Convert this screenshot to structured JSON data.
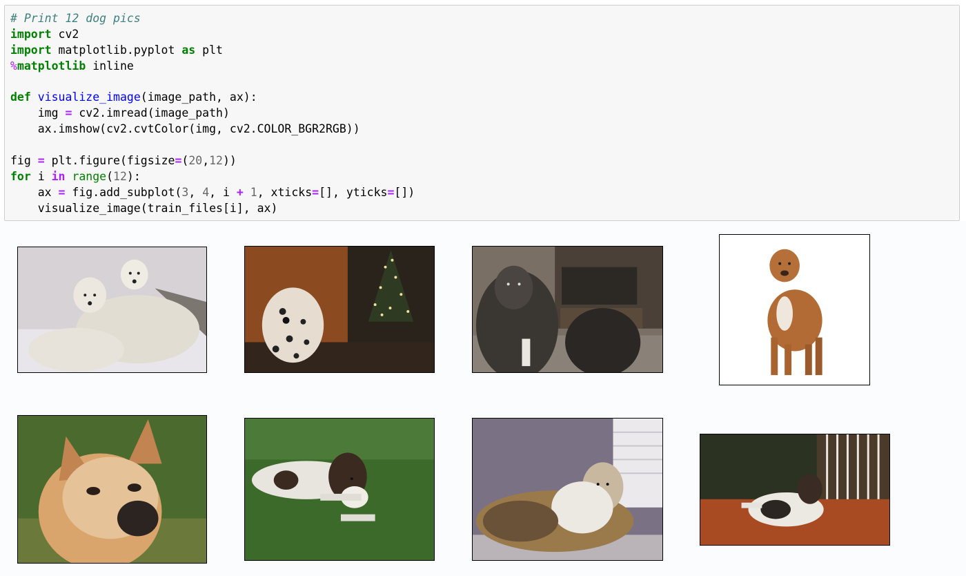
{
  "notebook": {
    "code_cell": {
      "lines": [
        [
          {
            "t": "cm",
            "v": "# Print 12 dog pics"
          }
        ],
        [
          {
            "t": "kw",
            "v": "import"
          },
          {
            "t": "",
            "v": " cv2"
          }
        ],
        [
          {
            "t": "kw",
            "v": "import"
          },
          {
            "t": "",
            "v": " matplotlib.pyplot "
          },
          {
            "t": "kw",
            "v": "as"
          },
          {
            "t": "",
            "v": " plt"
          }
        ],
        [
          {
            "t": "mg",
            "v": "%"
          },
          {
            "t": "kw",
            "v": "matplotlib"
          },
          {
            "t": "",
            "v": " inline"
          }
        ],
        [
          {
            "t": "",
            "v": " "
          }
        ],
        [
          {
            "t": "kw",
            "v": "def"
          },
          {
            "t": "",
            "v": " "
          },
          {
            "t": "fn",
            "v": "visualize_image"
          },
          {
            "t": "",
            "v": "(image_path, ax):"
          }
        ],
        [
          {
            "t": "",
            "v": "    img "
          },
          {
            "t": "op",
            "v": "="
          },
          {
            "t": "",
            "v": " cv2.imread(image_path)"
          }
        ],
        [
          {
            "t": "",
            "v": "    ax.imshow(cv2.cvtColor(img, cv2.COLOR_BGR2RGB))"
          }
        ],
        [
          {
            "t": "",
            "v": " "
          }
        ],
        [
          {
            "t": "",
            "v": "fig "
          },
          {
            "t": "op",
            "v": "="
          },
          {
            "t": "",
            "v": " plt.figure(figsize"
          },
          {
            "t": "op",
            "v": "="
          },
          {
            "t": "",
            "v": "("
          },
          {
            "t": "num",
            "v": "20"
          },
          {
            "t": "",
            "v": ","
          },
          {
            "t": "num",
            "v": "12"
          },
          {
            "t": "",
            "v": "))"
          }
        ],
        [
          {
            "t": "kw",
            "v": "for"
          },
          {
            "t": "",
            "v": " i "
          },
          {
            "t": "op",
            "v": "in"
          },
          {
            "t": "",
            "v": " "
          },
          {
            "t": "bi",
            "v": "range"
          },
          {
            "t": "",
            "v": "("
          },
          {
            "t": "num",
            "v": "12"
          },
          {
            "t": "",
            "v": "):"
          }
        ],
        [
          {
            "t": "",
            "v": "    ax "
          },
          {
            "t": "op",
            "v": "="
          },
          {
            "t": "",
            "v": " fig.add_subplot("
          },
          {
            "t": "num",
            "v": "3"
          },
          {
            "t": "",
            "v": ", "
          },
          {
            "t": "num",
            "v": "4"
          },
          {
            "t": "",
            "v": ", i "
          },
          {
            "t": "op",
            "v": "+"
          },
          {
            "t": "",
            "v": " "
          },
          {
            "t": "num",
            "v": "1"
          },
          {
            "t": "",
            "v": ", xticks"
          },
          {
            "t": "op",
            "v": "="
          },
          {
            "t": "",
            "v": "[], yticks"
          },
          {
            "t": "op",
            "v": "="
          },
          {
            "t": "",
            "v": "[])"
          }
        ],
        [
          {
            "t": "",
            "v": "    visualize_image(train_files[i], ax)"
          }
        ]
      ]
    },
    "output_images": [
      {
        "name": "two-white-dogs-in-snow",
        "scene": "snow"
      },
      {
        "name": "dalmatian-with-christmas-tree",
        "scene": "dalmatian"
      },
      {
        "name": "two-black-spaniels",
        "scene": "spaniels"
      },
      {
        "name": "brown-terrier-standing",
        "scene": "terrier"
      },
      {
        "name": "tan-puppy-closeup",
        "scene": "puppy"
      },
      {
        "name": "springer-spaniel-on-grass",
        "scene": "springer"
      },
      {
        "name": "collie-on-porch",
        "scene": "collie"
      },
      {
        "name": "spaniel-on-deck",
        "scene": "deck"
      }
    ]
  },
  "colors": {
    "keyword": "#008000",
    "comment": "#408080",
    "number": "#666666",
    "function": "#0000ff",
    "operator": "#aa22ff",
    "cell_background": "#f7f7f7",
    "cell_border": "#cfcfcf"
  }
}
